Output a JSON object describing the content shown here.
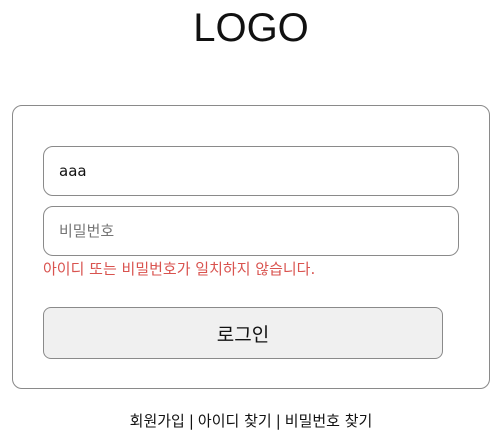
{
  "header": {
    "logo_text": "LOGO"
  },
  "login_form": {
    "id_value": "aaa",
    "password_value": "",
    "password_placeholder": "비밀번호",
    "error_message": "아이디 또는 비밀번호가 일치하지 않습니다.",
    "login_button_label": "로그인"
  },
  "footer_links": {
    "signup": "회원가입",
    "separator": "|",
    "find_id": "아이디 찾기",
    "find_password": "비밀번호 찾기"
  },
  "colors": {
    "error": "#d9534f",
    "border": "#8a8a8a",
    "button_bg": "#f0f0f0"
  }
}
